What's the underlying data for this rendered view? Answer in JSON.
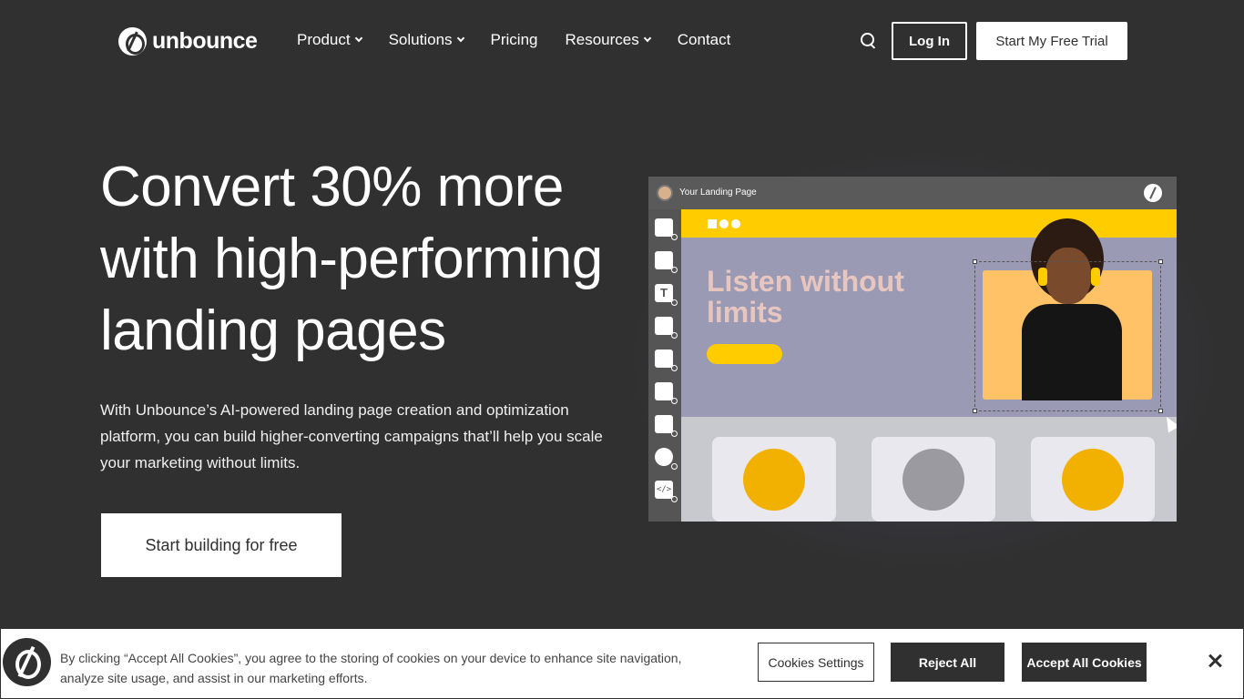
{
  "nav": {
    "logo_text": "unbounce",
    "menu": [
      {
        "label": "Product",
        "dropdown": true
      },
      {
        "label": "Solutions",
        "dropdown": true
      },
      {
        "label": "Pricing",
        "dropdown": false
      },
      {
        "label": "Resources",
        "dropdown": true
      },
      {
        "label": "Contact",
        "dropdown": false
      }
    ],
    "login_label": "Log In",
    "trial_label": "Start My Free Trial"
  },
  "hero": {
    "headline": "Convert 30% more with high-performing landing pages",
    "subtext": "With Unbounce’s AI-powered landing page creation and optimization platform, you can build higher-converting campaigns that’ll help you scale your marketing without limits.",
    "cta_label": "Start building for free"
  },
  "mockup": {
    "window_title": "Your Landing Page",
    "headline": "Listen without limits",
    "accent_color": "#ffcc00",
    "tools": [
      "layout-icon",
      "box-icon",
      "text-icon",
      "image-icon",
      "button-icon",
      "form-icon",
      "section-icon",
      "video-icon",
      "code-icon"
    ],
    "text_tool_glyph": "T",
    "code_tool_glyph": "</>"
  },
  "cookie": {
    "text": "By clicking “Accept All Cookies”, you agree to the storing of cookies on your device to enhance site navigation, analyze site usage, and assist in our marketing efforts.",
    "settings_label": "Cookies Settings",
    "reject_label": "Reject All",
    "accept_label": "Accept All Cookies"
  },
  "colors": {
    "background": "#303030",
    "white": "#ffffff",
    "mock_yellow": "#ffcc00",
    "mock_lavender": "#9a9ab5"
  }
}
